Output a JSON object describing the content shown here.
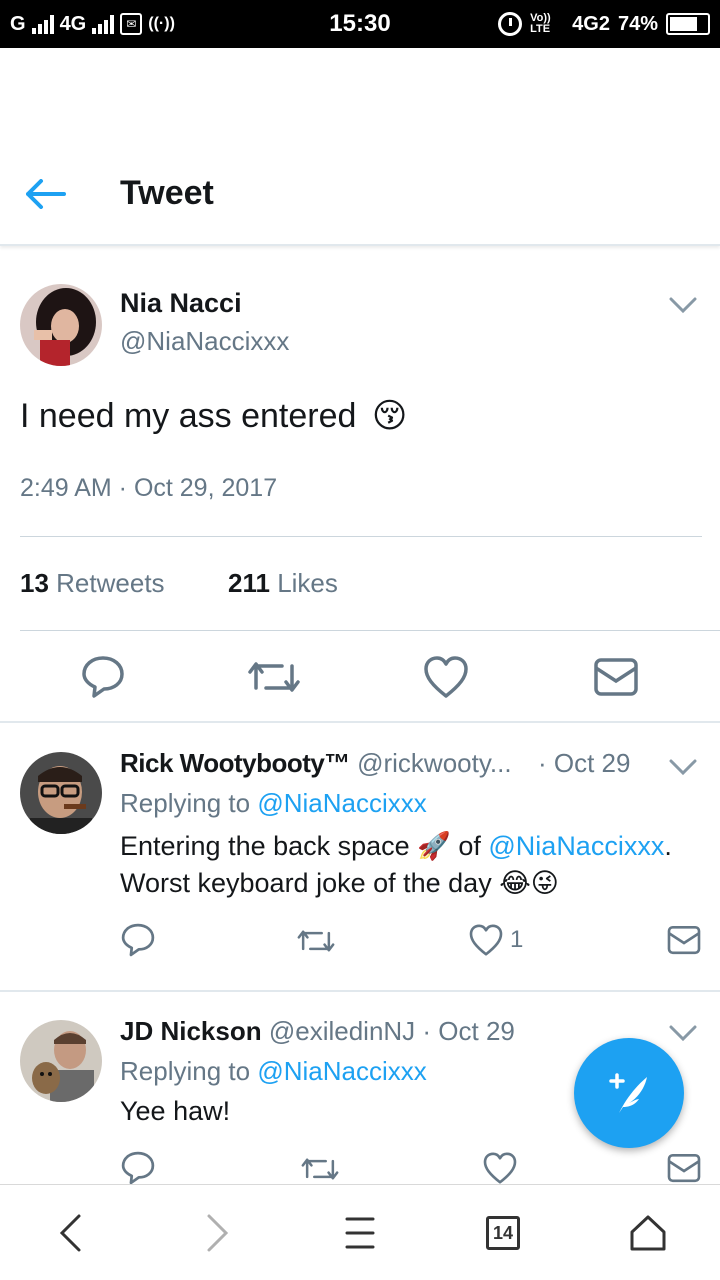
{
  "status_bar": {
    "carrier1": "G",
    "carrier2": "4G",
    "time": "15:30",
    "volte": "Vo)) LTE",
    "network": "4G2",
    "battery": "74%",
    "battery_level": 0.74
  },
  "header": {
    "title": "Tweet",
    "accent_color": "#1da1f2"
  },
  "main_tweet": {
    "display_name": "Nia Nacci",
    "handle": "@NiaNaccixxx",
    "text": "I need my ass entered",
    "emoji": "😚",
    "timestamp": "2:49 AM · Oct 29, 2017",
    "retweets_count": "13",
    "retweets_label": "Retweets",
    "likes_count": "211",
    "likes_label": "Likes"
  },
  "replies": [
    {
      "display_name": "Rick Wootybooty™",
      "handle": "@rickwooty...",
      "date": "· Oct 29",
      "replying_prefix": "Replying to",
      "replying_to": "@NiaNaccixxx",
      "line1_text": "Entering the back space",
      "line1_emoji": "🚀",
      "line1_of": "of",
      "line1_mention": "@NiaNaccixxx",
      "line1_end": ".",
      "line2_text": "Worst keyboard joke of the day",
      "line2_emoji": "😂😜",
      "like_count": "1"
    },
    {
      "display_name": "JD Nickson",
      "handle": "@exiledinNJ",
      "date": "· Oct 29",
      "replying_prefix": "Replying to",
      "replying_to": "@NiaNaccixxx",
      "text": "Yee haw!"
    }
  ],
  "bottom_bar": {
    "tab_count": "14"
  },
  "icons": [
    "back-arrow-icon",
    "chevron-down-icon",
    "reply-icon",
    "retweet-icon",
    "like-icon",
    "direct-message-icon",
    "compose-tweet-icon",
    "browser-back-icon",
    "browser-forward-icon",
    "menu-icon",
    "tabs-icon",
    "home-icon"
  ]
}
